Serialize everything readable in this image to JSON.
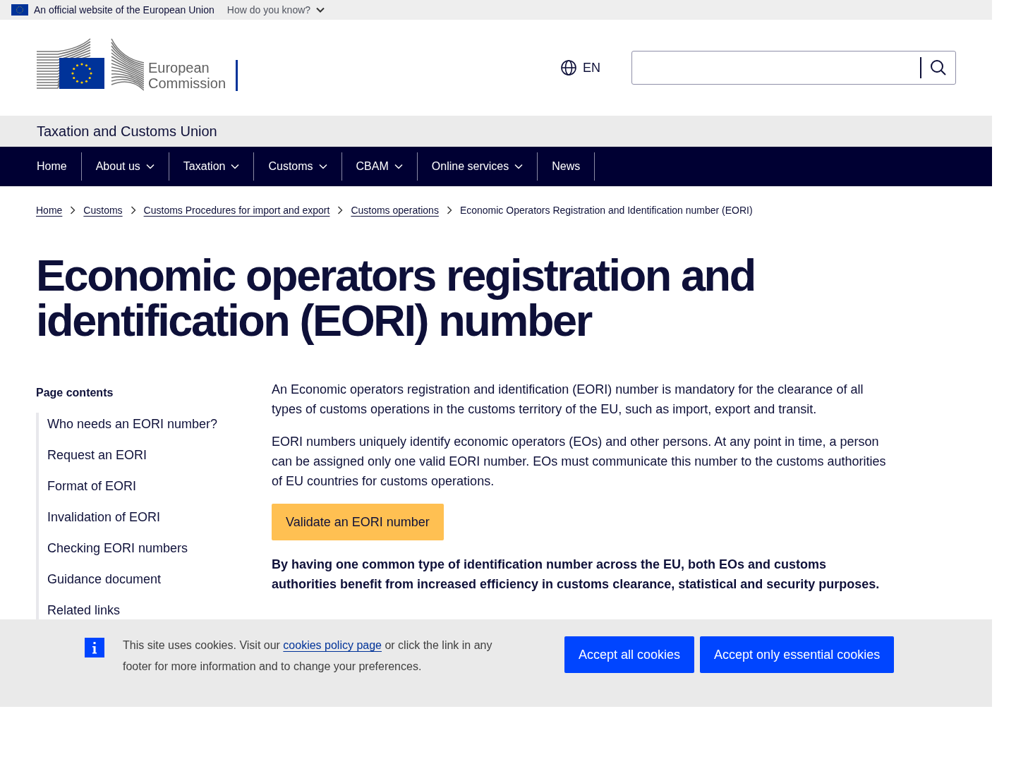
{
  "top_bar": {
    "text": "An official website of the European Union",
    "link": "How do you know?"
  },
  "header": {
    "logo_text": [
      "European",
      "Commission"
    ],
    "language": "EN"
  },
  "site_name": "Taxation and Customs Union",
  "nav": [
    {
      "label": "Home",
      "has_dropdown": false
    },
    {
      "label": "About us",
      "has_dropdown": true
    },
    {
      "label": "Taxation",
      "has_dropdown": true
    },
    {
      "label": "Customs",
      "has_dropdown": true
    },
    {
      "label": "CBAM",
      "has_dropdown": true
    },
    {
      "label": "Online services",
      "has_dropdown": true
    },
    {
      "label": "News",
      "has_dropdown": false
    }
  ],
  "breadcrumb": [
    {
      "label": "Home",
      "link": true
    },
    {
      "label": "Customs",
      "link": true
    },
    {
      "label": "Customs Procedures for import and export",
      "link": true
    },
    {
      "label": "Customs operations",
      "link": true
    },
    {
      "label": "Economic Operators Registration and Identification number (EORI)",
      "link": false
    }
  ],
  "title": "Economic operators registration and identification (EORI) number",
  "page_contents": {
    "heading": "Page contents",
    "items": [
      "Who needs an EORI number?",
      "Request an EORI",
      "Format of EORI",
      "Invalidation of EORI",
      "Checking EORI numbers",
      "Guidance document",
      "Related links"
    ]
  },
  "body": {
    "paragraphs": [
      "An Economic operators registration and identification (EORI) number is mandatory for the clearance of all types of customs operations in the customs territory of the EU, such as import, export and transit.",
      "EORI numbers uniquely identify economic operators (EOs) and other persons. At any point in time, a person can be assigned only one valid EORI number. EOs must communicate this number to the customs authorities of EU countries for customs operations."
    ],
    "button": "Validate an EORI number",
    "highlight": "By having one common type of identification number across the EU, both EOs and customs authorities benefit from increased efficiency in customs clearance, statistical and security purposes."
  },
  "cookie_banner": {
    "text_before": "This site uses cookies. Visit our",
    "link": "cookies policy page",
    "text_after": "or click the link in any footer for more information and to change your preferences.",
    "buttons": [
      "Accept all cookies",
      "Accept only essential cookies"
    ]
  }
}
